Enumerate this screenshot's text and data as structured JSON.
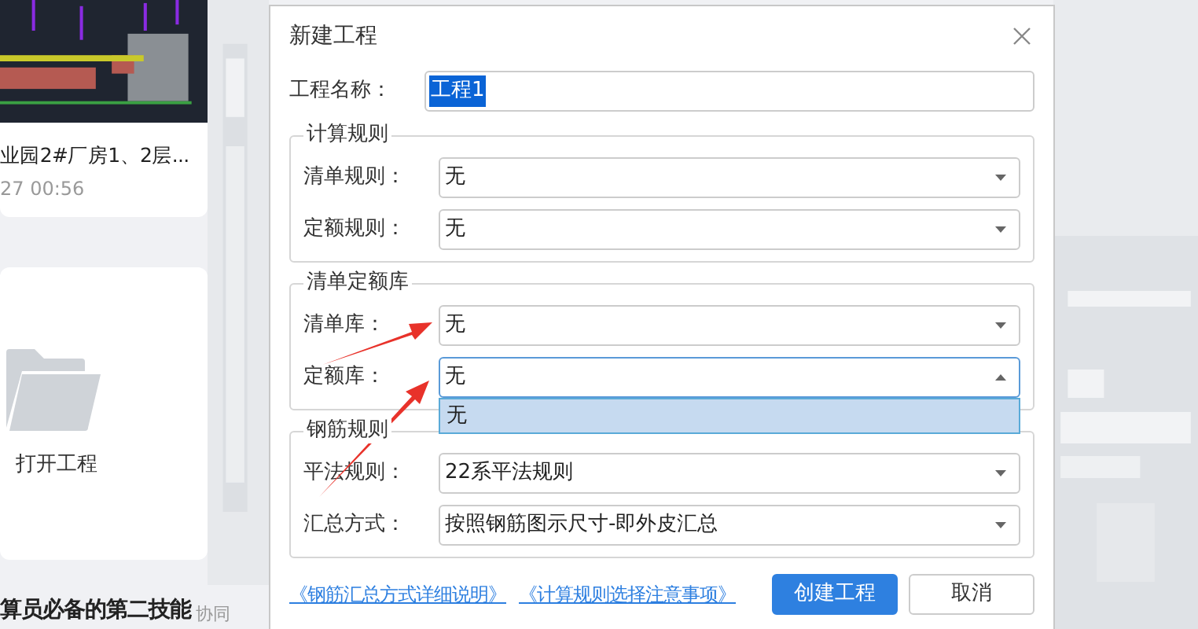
{
  "background": {
    "cards": [
      {
        "title": "业园2#厂房1、2层...",
        "time": "27 00:56"
      }
    ],
    "open_project": {
      "label": "打开工程"
    },
    "headline": {
      "text": "算员必备的第二技能",
      "tag": "协同"
    }
  },
  "dialog": {
    "title": "新建工程",
    "name_field": {
      "label": "工程名称：",
      "value": "工程1",
      "selected": true
    },
    "groups": [
      {
        "title": "计算规则",
        "fields": [
          {
            "label": "清单规则：",
            "value": "无",
            "expanded": false
          },
          {
            "label": "定额规则：",
            "value": "无",
            "expanded": false
          }
        ]
      },
      {
        "title": "清单定额库",
        "fields": [
          {
            "label": "清单库：",
            "value": "无",
            "expanded": false
          },
          {
            "label": "定额库：",
            "value": "无",
            "expanded": true,
            "options": [
              {
                "label": "无",
                "selected": true
              }
            ]
          }
        ]
      },
      {
        "title": "钢筋规则",
        "fields": [
          {
            "label": "平法规则：",
            "value": "22系平法规则",
            "expanded": false
          },
          {
            "label": "汇总方式：",
            "value": "按照钢筋图示尺寸-即外皮汇总",
            "expanded": false
          }
        ]
      }
    ],
    "links": [
      "《钢筋汇总方式详细说明》",
      "《计算规则选择注意事项》"
    ],
    "buttons": [
      {
        "label": "创建工程",
        "kind": "primary"
      },
      {
        "label": "取消",
        "kind": "secondary"
      }
    ]
  }
}
